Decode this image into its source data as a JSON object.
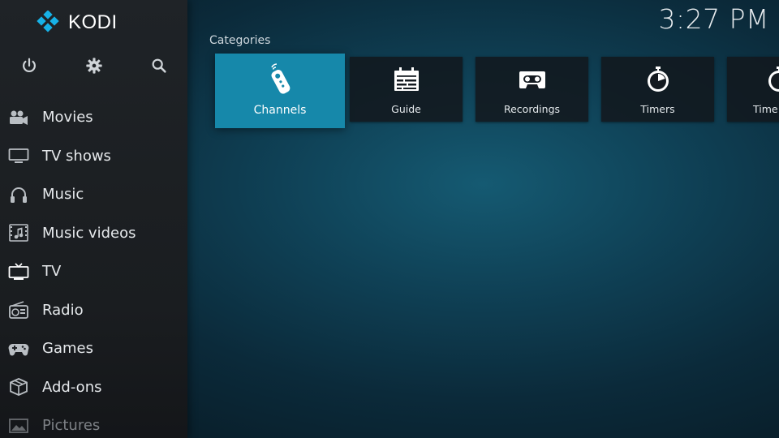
{
  "app": {
    "brand": "KODI",
    "clock": "3:27 PM"
  },
  "top_actions": {
    "icons": [
      "power-icon",
      "gear-icon",
      "search-icon"
    ]
  },
  "sidebar": {
    "items": [
      {
        "label": "Movies",
        "icon": "movie-camera-icon"
      },
      {
        "label": "TV shows",
        "icon": "monitor-icon"
      },
      {
        "label": "Music",
        "icon": "headphones-icon"
      },
      {
        "label": "Music videos",
        "icon": "music-video-icon"
      },
      {
        "label": "TV",
        "icon": "tv-icon"
      },
      {
        "label": "Radio",
        "icon": "radio-icon"
      },
      {
        "label": "Games",
        "icon": "gamepad-icon"
      },
      {
        "label": "Add-ons",
        "icon": "addons-box-icon"
      },
      {
        "label": "Pictures",
        "icon": "picture-icon"
      }
    ]
  },
  "main": {
    "section_title": "Categories",
    "tiles": [
      {
        "label": "Channels",
        "icon": "remote-control-icon",
        "focused": true
      },
      {
        "label": "Guide",
        "icon": "calendar-grid-icon"
      },
      {
        "label": "Recordings",
        "icon": "cassette-icon"
      },
      {
        "label": "Timers",
        "icon": "stopwatch-icon"
      },
      {
        "label": "Time",
        "icon": "stopwatch-icon"
      }
    ]
  },
  "colors": {
    "focus_tile": "#1688aa",
    "sidebar_bg": "#1f2327",
    "brand_blue": "#17b2e7"
  }
}
